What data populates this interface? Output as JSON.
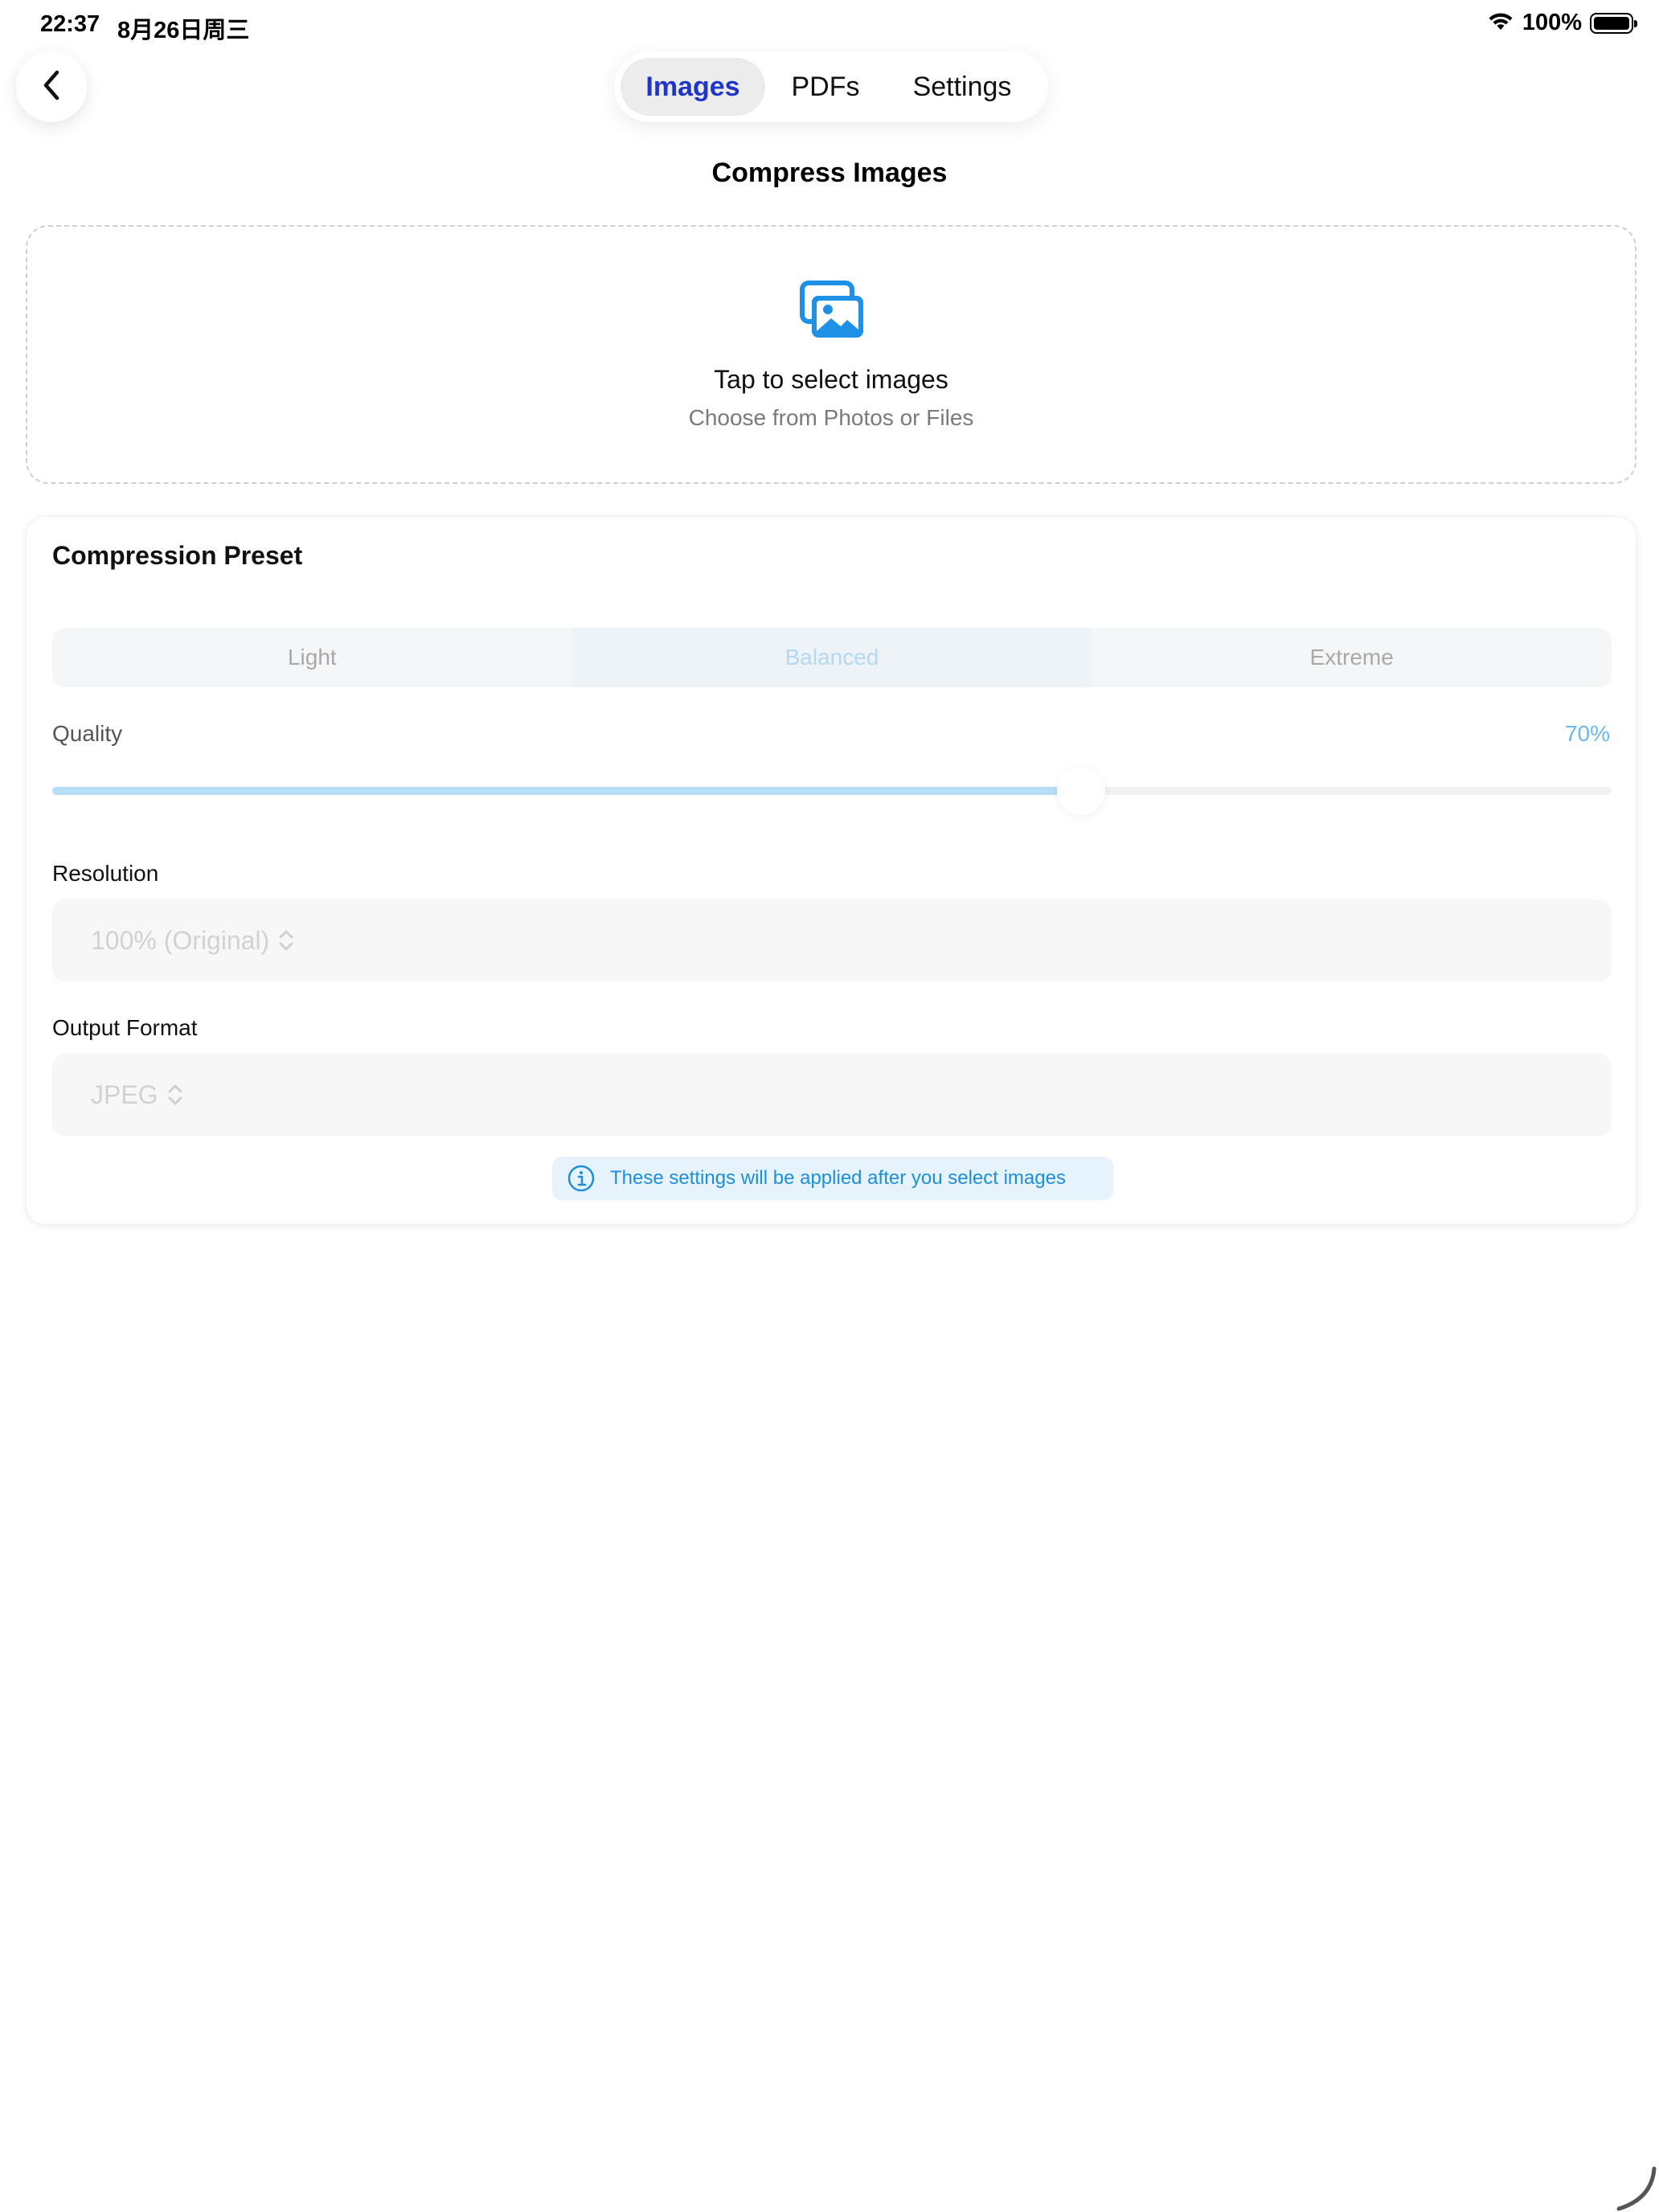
{
  "status_bar": {
    "time": "22:37",
    "date": "8月26日周三",
    "battery": "100%"
  },
  "tabs": [
    {
      "label": "Images",
      "active": true
    },
    {
      "label": "PDFs",
      "active": false
    },
    {
      "label": "Settings",
      "active": false
    }
  ],
  "page": {
    "title": "Compress Images"
  },
  "drop_zone": {
    "icon": "photo-stack-icon",
    "title": "Tap to select images",
    "subtitle": "Choose from Photos or Files"
  },
  "settings": {
    "heading": "Compression Preset",
    "presets": [
      {
        "label": "Light",
        "selected": false
      },
      {
        "label": "Balanced",
        "selected": true
      },
      {
        "label": "Extreme",
        "selected": false
      }
    ],
    "quality": {
      "label": "Quality",
      "value_text": "70%",
      "value": 0.66
    },
    "resolution": {
      "label": "Resolution",
      "value": "100% (Original)"
    },
    "output_format": {
      "label": "Output Format",
      "value": "JPEG"
    },
    "info": "These settings will be applied after you select images"
  },
  "colors": {
    "accent": "#1e90e6",
    "active_tab_text": "#1f36c9",
    "slider_fill": "#b7dcf6"
  }
}
